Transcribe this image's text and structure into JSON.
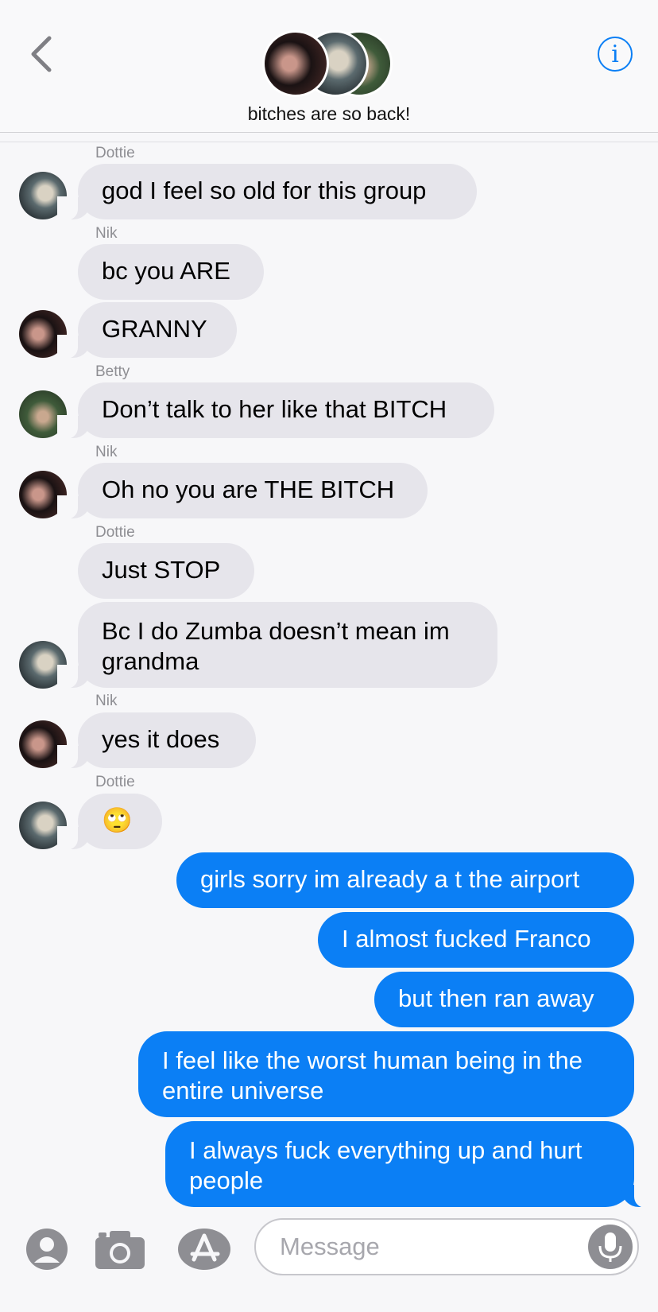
{
  "header": {
    "title": "bitches are so back!",
    "back_icon": "chevron-left-icon",
    "info_icon": "info-icon",
    "accent_color": "#0b7ff5"
  },
  "messages": [
    {
      "sender": "Dottie",
      "text": "god I feel so old for this group",
      "direction": "incoming"
    },
    {
      "sender": "Nik",
      "text": "bc you ARE",
      "direction": "incoming"
    },
    {
      "sender": "Nik",
      "text": "GRANNY",
      "direction": "incoming"
    },
    {
      "sender": "Betty",
      "text": "Don’t talk to her like that BITCH",
      "direction": "incoming"
    },
    {
      "sender": "Nik",
      "text": "Oh no you are THE BITCH",
      "direction": "incoming"
    },
    {
      "sender": "Dottie",
      "text": "Just STOP",
      "direction": "incoming"
    },
    {
      "sender": "Dottie",
      "text": "Bc I do Zumba doesn’t mean im grandma",
      "direction": "incoming"
    },
    {
      "sender": "Nik",
      "text": "yes it does",
      "direction": "incoming"
    },
    {
      "sender": "Dottie",
      "text": "🙄",
      "direction": "incoming"
    },
    {
      "text": "girls sorry im already a t the airport",
      "direction": "outgoing"
    },
    {
      "text": "I almost fucked Franco",
      "direction": "outgoing"
    },
    {
      "text": "but then ran away",
      "direction": "outgoing"
    },
    {
      "text": "I feel like the worst human being in the entire universe",
      "direction": "outgoing"
    },
    {
      "text": "I always fuck everything up and hurt people",
      "direction": "outgoing"
    }
  ],
  "input": {
    "placeholder": "Message",
    "icons": [
      "contact-icon",
      "camera-icon",
      "app-store-icon",
      "microphone-icon"
    ]
  },
  "colors": {
    "incoming_bubble": "#e6e5eb",
    "outgoing_bubble": "#0b7ff5",
    "background": "#f7f7f9"
  }
}
